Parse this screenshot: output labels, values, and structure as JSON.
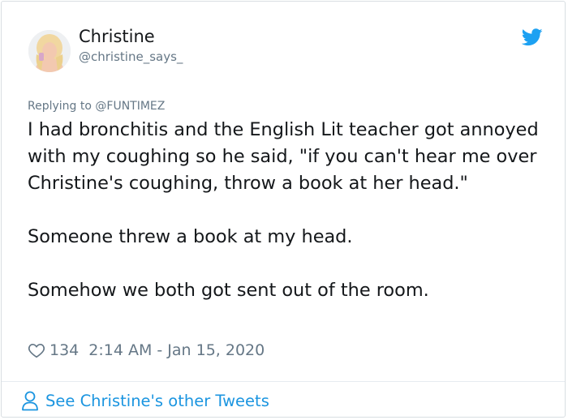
{
  "author": {
    "name": "Christine",
    "handle": "@christine_says_"
  },
  "replying_to": {
    "prefix": "Replying to",
    "mention": "@FUNTIMEZ"
  },
  "tweet": {
    "paragraphs": [
      "I had bronchitis and the English Lit teacher got annoyed with my coughing so he said, \"if you can't hear me over Christine's coughing, throw a book at her head.\"",
      "Someone threw a book at my head.",
      "Somehow we both got sent out of the room."
    ]
  },
  "meta": {
    "like_count": "134",
    "timestamp": "2:14 AM - Jan 15, 2020"
  },
  "footer": {
    "link_text": "See Christine's other Tweets"
  },
  "colors": {
    "twitter_blue": "#1da1f2",
    "link_blue": "#1b95e0",
    "text": "#14171a",
    "muted": "#657786"
  },
  "icons": [
    "twitter-bird-icon",
    "heart-icon",
    "person-icon"
  ]
}
